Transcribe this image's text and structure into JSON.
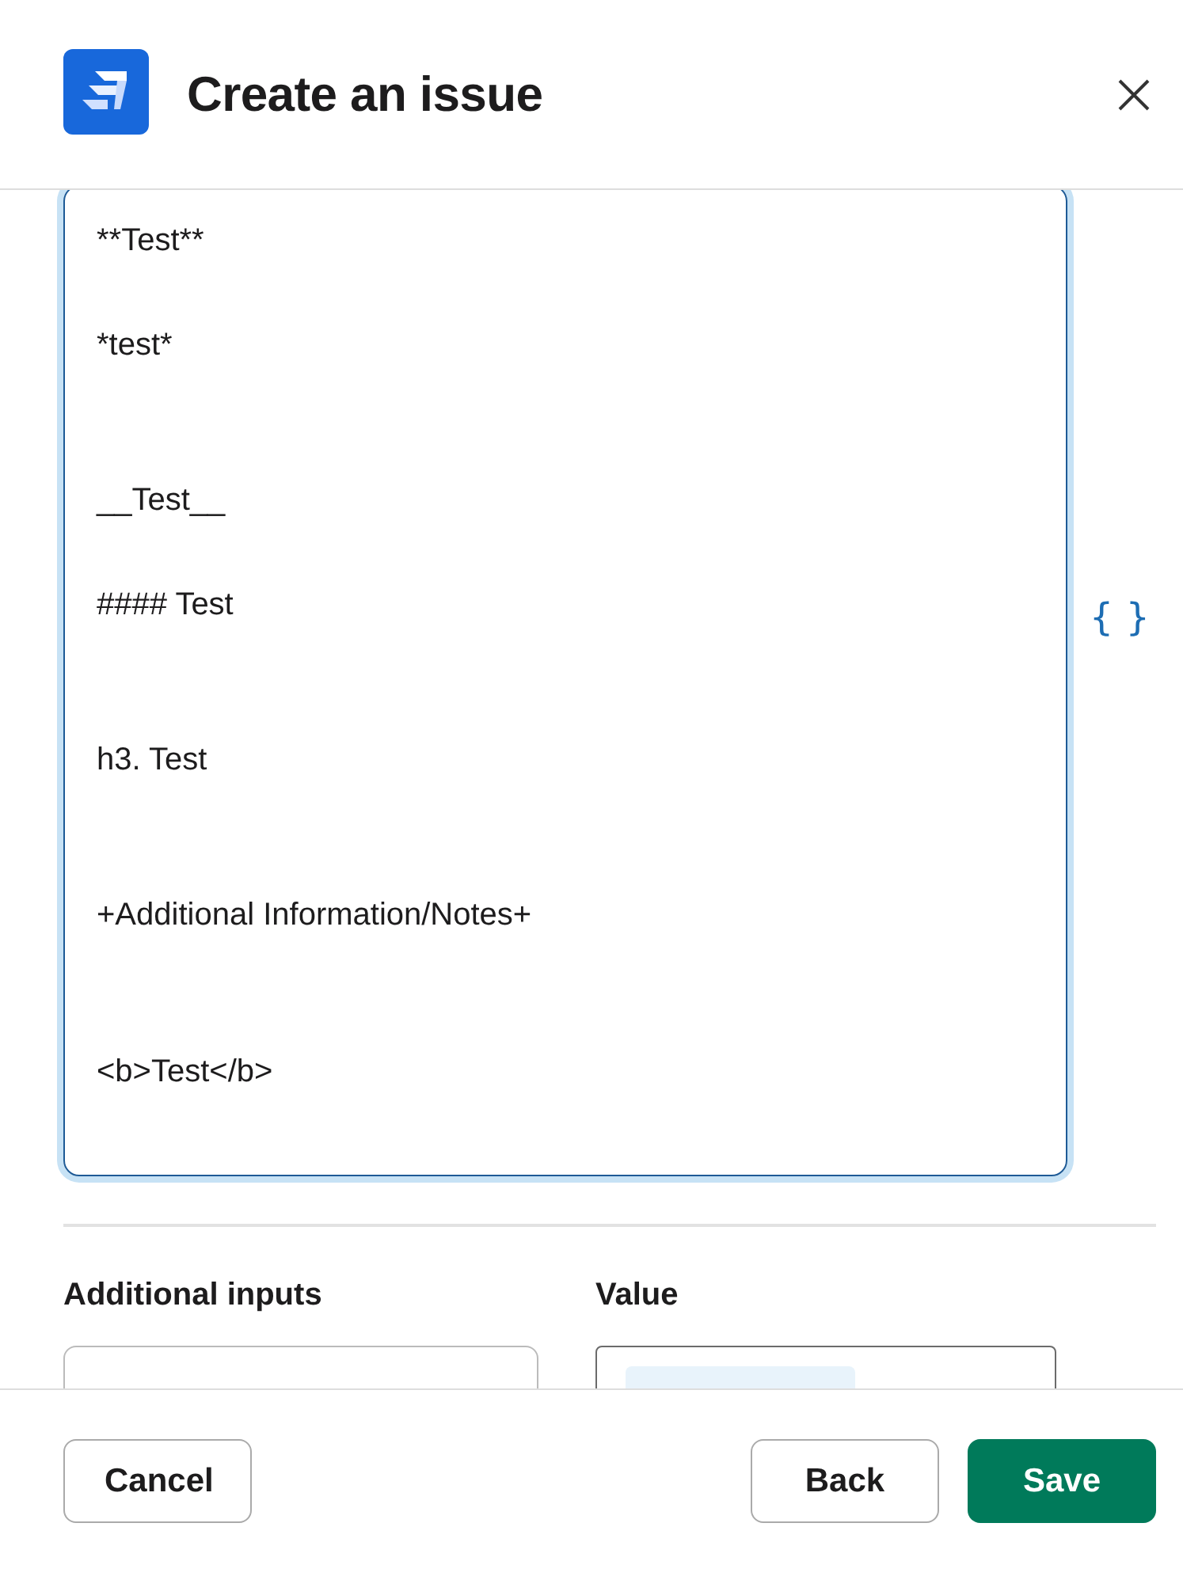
{
  "dialog": {
    "title": "Create an issue"
  },
  "editor": {
    "value": "**Test**\n\n*test*\n\n\n__Test__\n\n#### Test\n\n\nh3. Test\n\n\n+Additional Information/Notes+\n\n\n<b>Test</b>",
    "focused": true
  },
  "variable_button": {
    "label": "{ }"
  },
  "inputs": {
    "columns": [
      {
        "label": "Additional inputs",
        "kind": "text"
      },
      {
        "label": "Value",
        "kind": "token"
      }
    ]
  },
  "footer": {
    "buttons": [
      {
        "label": "Cancel",
        "kind": "secondary"
      },
      {
        "label": "Back",
        "kind": "secondary"
      },
      {
        "label": "Save",
        "kind": "primary"
      }
    ]
  }
}
